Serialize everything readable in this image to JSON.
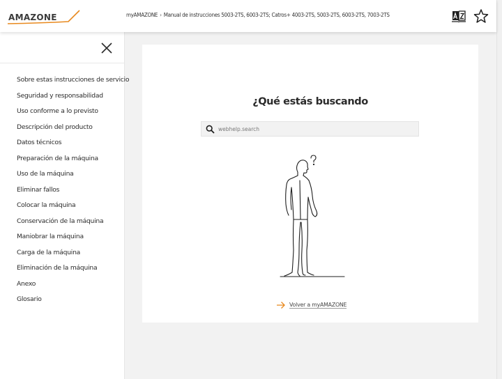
{
  "header": {
    "logo_text": "AMAZONE",
    "breadcrumb": {
      "home": "myAMAZONE",
      "separator": "›",
      "current": "Manual de instrucciones 5003-2TS, 6003-2TS; Catros+ 4003-2TS, 5003-2TS, 6003-2TS, 7003-2TS"
    },
    "icons": {
      "language": "language-book-icon",
      "favorite": "star-icon"
    }
  },
  "sidebar": {
    "close_icon": "close-icon",
    "items": [
      {
        "label": "Sobre estas instrucciones de servicio"
      },
      {
        "label": "Seguridad y responsabilidad"
      },
      {
        "label": "Uso conforme a lo previsto"
      },
      {
        "label": "Descripción del producto"
      },
      {
        "label": "Datos técnicos"
      },
      {
        "label": "Preparación de la máquina"
      },
      {
        "label": "Uso de la máquina"
      },
      {
        "label": "Eliminar fallos"
      },
      {
        "label": "Colocar la máquina"
      },
      {
        "label": "Conservación de la máquina"
      },
      {
        "label": "Maniobrar la máquina"
      },
      {
        "label": "Carga de la máquina"
      },
      {
        "label": "Eliminación de la máquina"
      },
      {
        "label": "Anexo"
      },
      {
        "label": "Glosario"
      }
    ]
  },
  "main": {
    "title": "¿Qué estás buscando",
    "search": {
      "placeholder": "webhelp.search",
      "value": ""
    },
    "illustration": "person-thinking-illustration",
    "back_link": "Volver a myAMAZONE"
  },
  "colors": {
    "accent": "#e8891e",
    "text": "#2b2b2b",
    "background": "#f2f2f2"
  }
}
